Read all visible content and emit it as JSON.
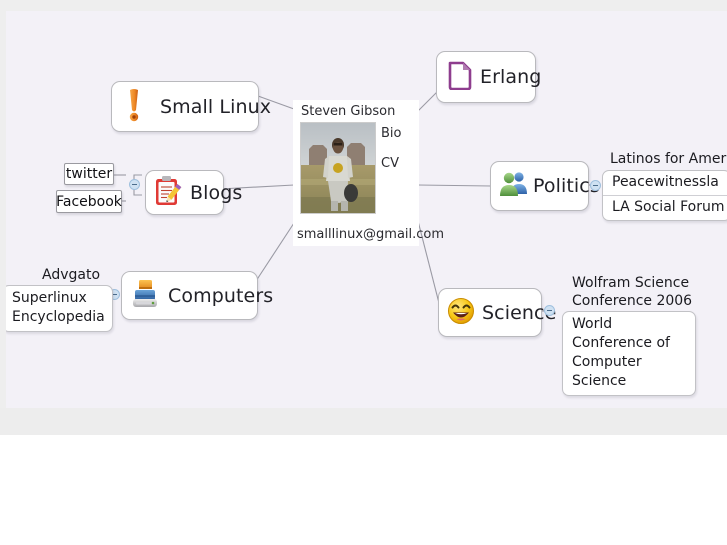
{
  "canvas": {
    "background": "#f3f1f7",
    "chrome_color": "#eeeeee"
  },
  "root": {
    "name": "Steven Gibson",
    "links": [
      "Bio",
      "CV"
    ],
    "bio_label": "Bio",
    "cv_label": "CV",
    "email": "smalllinux@gmail.com",
    "photo_alt": "portrait-photo-desert-landscape"
  },
  "nodes": [
    {
      "id": "small-linux",
      "label": "Small Linux",
      "icon": "exclamation-mark-icon",
      "icon_color": "#e8822a"
    },
    {
      "id": "blogs",
      "label": "Blogs",
      "icon": "clipboard-pencil-icon",
      "icon_color": "#d32f2f"
    },
    {
      "id": "computers",
      "label": "Computers",
      "icon": "printer-icon",
      "icon_color": "#3a73b8"
    },
    {
      "id": "erlang",
      "label": "Erlang",
      "icon": "document-page-icon",
      "icon_color": "#8e3d8e"
    },
    {
      "id": "politics",
      "label": "Politics",
      "icon": "people-group-icon",
      "icon_color": "#6aa84f"
    },
    {
      "id": "science",
      "label": "Science",
      "icon": "smiley-face-icon",
      "icon_color": "#f2c40c"
    }
  ],
  "leaves": {
    "blogs": [
      "twitter",
      "Facebook"
    ],
    "computers": {
      "floating": "Advgato",
      "boxed": "Superlinux Encyclopedia",
      "boxed_line1": "Superlinux",
      "boxed_line2": "Encyclopedia"
    },
    "politics": {
      "floating": "Latinos for America",
      "rows": [
        "Peacewitnessla",
        "LA Social Forum"
      ]
    },
    "science": {
      "row1_line1": "Wolfram Science",
      "row1_line2": "Conference 2006",
      "row2_line1": "World Conference of",
      "row2_line2": "Computer Science"
    }
  }
}
